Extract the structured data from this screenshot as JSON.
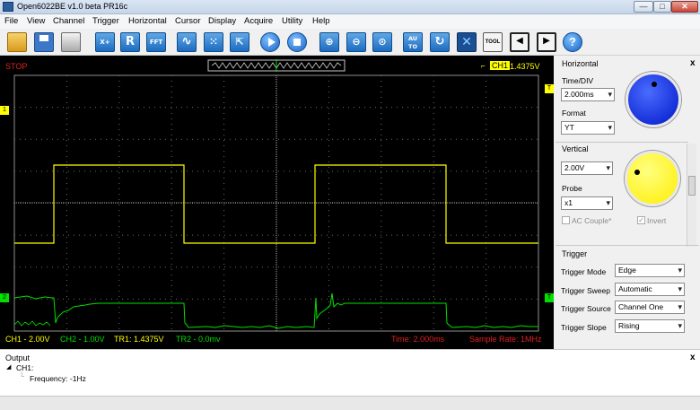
{
  "window": {
    "title": "Open6022BE v1.0 beta PR16c",
    "min": "—",
    "max": "□",
    "close": "✕"
  },
  "menu": [
    "File",
    "View",
    "Channel",
    "Trigger",
    "Horizontal",
    "Cursor",
    "Display",
    "Acquire",
    "Utility",
    "Help"
  ],
  "toolbar": {
    "icons": [
      "open-folder-icon",
      "save-disk-icon",
      "print-icon",
      "math-icon",
      "reference-icon",
      "fft-icon",
      "sine-wave-icon",
      "grid-icon",
      "cursor-icon",
      "run-icon",
      "stop-icon",
      "zoom-in-icon",
      "zoom-out-icon",
      "zoom-fit-icon",
      "auto-icon",
      "refresh-icon",
      "fullscreen-icon",
      "tool-icon",
      "prev-page-icon",
      "next-page-icon",
      "help-icon"
    ],
    "math_label": "X+",
    "ref_label": "R",
    "fft_label": "FFT",
    "auto_label": "AU TO",
    "tool_label": "TOOL",
    "help_label": "?"
  },
  "scope": {
    "state": "STOP",
    "trigger_channel": "CH1",
    "trigger_level": "1.4375V",
    "ch1_marker": "1",
    "ch2_marker": "2",
    "trigger_marker": "T",
    "status": {
      "ch1": "CH1 - 2.00V",
      "ch2": "CH2 - 1.00V",
      "tr1": "TR1: 1.4375V",
      "tr2": "TR2 - 0.0mv",
      "time": "Time: 2.000ms",
      "sample_rate": "Sample Rate: 1MHz"
    },
    "colors": {
      "ch1": "#ffff00",
      "ch2": "#00e000",
      "state": "#e02020",
      "status_right": "#e02020",
      "trigger_box": "#ffff00"
    }
  },
  "horizontal": {
    "title": "Horizontal",
    "close": "x",
    "time_div_label": "Time/DIV",
    "time_div_value": "2.000ms",
    "format_label": "Format",
    "format_value": "YT",
    "knob_color": "#0033ff"
  },
  "vertical": {
    "title": "Vertical",
    "volts_value": "2.00V",
    "probe_label": "Probe",
    "probe_value": "x1",
    "ac_couple_label": "AC Couple*",
    "invert_label": "Invert",
    "knob_color": "#ffff00"
  },
  "trigger": {
    "title": "Trigger",
    "rows": [
      {
        "label": "Trigger Mode",
        "value": "Edge"
      },
      {
        "label": "Trigger Sweep",
        "value": "Automatic"
      },
      {
        "label": "Trigger Source",
        "value": "Channel One"
      },
      {
        "label": "Trigger Slope",
        "value": "Rising"
      }
    ]
  },
  "output": {
    "title": "Output",
    "close": "x",
    "tree_root": "CH1:",
    "tree_child": "Frequency: -1Hz"
  }
}
